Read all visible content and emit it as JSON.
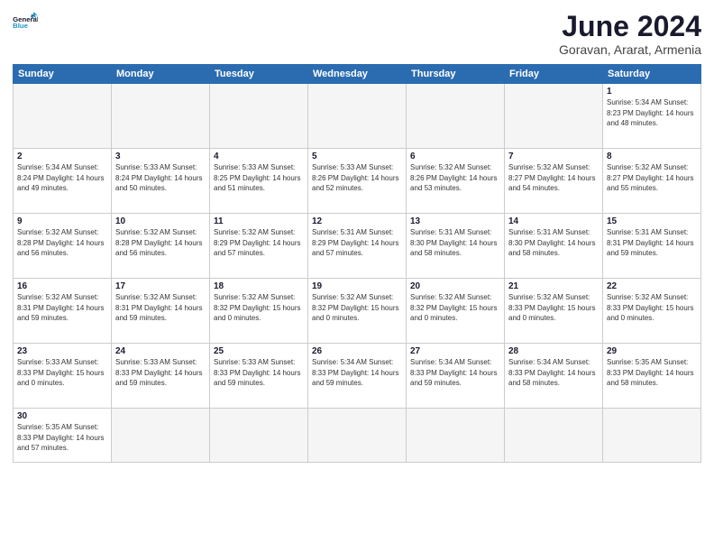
{
  "header": {
    "logo_general": "General",
    "logo_blue": "Blue",
    "month_title": "June 2024",
    "subtitle": "Goravan, Ararat, Armenia"
  },
  "weekdays": [
    "Sunday",
    "Monday",
    "Tuesday",
    "Wednesday",
    "Thursday",
    "Friday",
    "Saturday"
  ],
  "weeks": [
    [
      {
        "day": "",
        "info": ""
      },
      {
        "day": "",
        "info": ""
      },
      {
        "day": "",
        "info": ""
      },
      {
        "day": "",
        "info": ""
      },
      {
        "day": "",
        "info": ""
      },
      {
        "day": "",
        "info": ""
      },
      {
        "day": "1",
        "info": "Sunrise: 5:34 AM\nSunset: 8:23 PM\nDaylight: 14 hours\nand 48 minutes."
      }
    ],
    [
      {
        "day": "2",
        "info": "Sunrise: 5:34 AM\nSunset: 8:24 PM\nDaylight: 14 hours\nand 49 minutes."
      },
      {
        "day": "3",
        "info": "Sunrise: 5:33 AM\nSunset: 8:24 PM\nDaylight: 14 hours\nand 50 minutes."
      },
      {
        "day": "4",
        "info": "Sunrise: 5:33 AM\nSunset: 8:25 PM\nDaylight: 14 hours\nand 51 minutes."
      },
      {
        "day": "5",
        "info": "Sunrise: 5:33 AM\nSunset: 8:26 PM\nDaylight: 14 hours\nand 52 minutes."
      },
      {
        "day": "6",
        "info": "Sunrise: 5:32 AM\nSunset: 8:26 PM\nDaylight: 14 hours\nand 53 minutes."
      },
      {
        "day": "7",
        "info": "Sunrise: 5:32 AM\nSunset: 8:27 PM\nDaylight: 14 hours\nand 54 minutes."
      },
      {
        "day": "8",
        "info": "Sunrise: 5:32 AM\nSunset: 8:27 PM\nDaylight: 14 hours\nand 55 minutes."
      }
    ],
    [
      {
        "day": "9",
        "info": "Sunrise: 5:32 AM\nSunset: 8:28 PM\nDaylight: 14 hours\nand 56 minutes."
      },
      {
        "day": "10",
        "info": "Sunrise: 5:32 AM\nSunset: 8:28 PM\nDaylight: 14 hours\nand 56 minutes."
      },
      {
        "day": "11",
        "info": "Sunrise: 5:32 AM\nSunset: 8:29 PM\nDaylight: 14 hours\nand 57 minutes."
      },
      {
        "day": "12",
        "info": "Sunrise: 5:31 AM\nSunset: 8:29 PM\nDaylight: 14 hours\nand 57 minutes."
      },
      {
        "day": "13",
        "info": "Sunrise: 5:31 AM\nSunset: 8:30 PM\nDaylight: 14 hours\nand 58 minutes."
      },
      {
        "day": "14",
        "info": "Sunrise: 5:31 AM\nSunset: 8:30 PM\nDaylight: 14 hours\nand 58 minutes."
      },
      {
        "day": "15",
        "info": "Sunrise: 5:31 AM\nSunset: 8:31 PM\nDaylight: 14 hours\nand 59 minutes."
      }
    ],
    [
      {
        "day": "16",
        "info": "Sunrise: 5:32 AM\nSunset: 8:31 PM\nDaylight: 14 hours\nand 59 minutes."
      },
      {
        "day": "17",
        "info": "Sunrise: 5:32 AM\nSunset: 8:31 PM\nDaylight: 14 hours\nand 59 minutes."
      },
      {
        "day": "18",
        "info": "Sunrise: 5:32 AM\nSunset: 8:32 PM\nDaylight: 15 hours\nand 0 minutes."
      },
      {
        "day": "19",
        "info": "Sunrise: 5:32 AM\nSunset: 8:32 PM\nDaylight: 15 hours\nand 0 minutes."
      },
      {
        "day": "20",
        "info": "Sunrise: 5:32 AM\nSunset: 8:32 PM\nDaylight: 15 hours\nand 0 minutes."
      },
      {
        "day": "21",
        "info": "Sunrise: 5:32 AM\nSunset: 8:33 PM\nDaylight: 15 hours\nand 0 minutes."
      },
      {
        "day": "22",
        "info": "Sunrise: 5:32 AM\nSunset: 8:33 PM\nDaylight: 15 hours\nand 0 minutes."
      }
    ],
    [
      {
        "day": "23",
        "info": "Sunrise: 5:33 AM\nSunset: 8:33 PM\nDaylight: 15 hours\nand 0 minutes."
      },
      {
        "day": "24",
        "info": "Sunrise: 5:33 AM\nSunset: 8:33 PM\nDaylight: 14 hours\nand 59 minutes."
      },
      {
        "day": "25",
        "info": "Sunrise: 5:33 AM\nSunset: 8:33 PM\nDaylight: 14 hours\nand 59 minutes."
      },
      {
        "day": "26",
        "info": "Sunrise: 5:34 AM\nSunset: 8:33 PM\nDaylight: 14 hours\nand 59 minutes."
      },
      {
        "day": "27",
        "info": "Sunrise: 5:34 AM\nSunset: 8:33 PM\nDaylight: 14 hours\nand 59 minutes."
      },
      {
        "day": "28",
        "info": "Sunrise: 5:34 AM\nSunset: 8:33 PM\nDaylight: 14 hours\nand 58 minutes."
      },
      {
        "day": "29",
        "info": "Sunrise: 5:35 AM\nSunset: 8:33 PM\nDaylight: 14 hours\nand 58 minutes."
      }
    ],
    [
      {
        "day": "30",
        "info": "Sunrise: 5:35 AM\nSunset: 8:33 PM\nDaylight: 14 hours\nand 57 minutes."
      },
      {
        "day": "",
        "info": ""
      },
      {
        "day": "",
        "info": ""
      },
      {
        "day": "",
        "info": ""
      },
      {
        "day": "",
        "info": ""
      },
      {
        "day": "",
        "info": ""
      },
      {
        "day": "",
        "info": ""
      }
    ]
  ]
}
